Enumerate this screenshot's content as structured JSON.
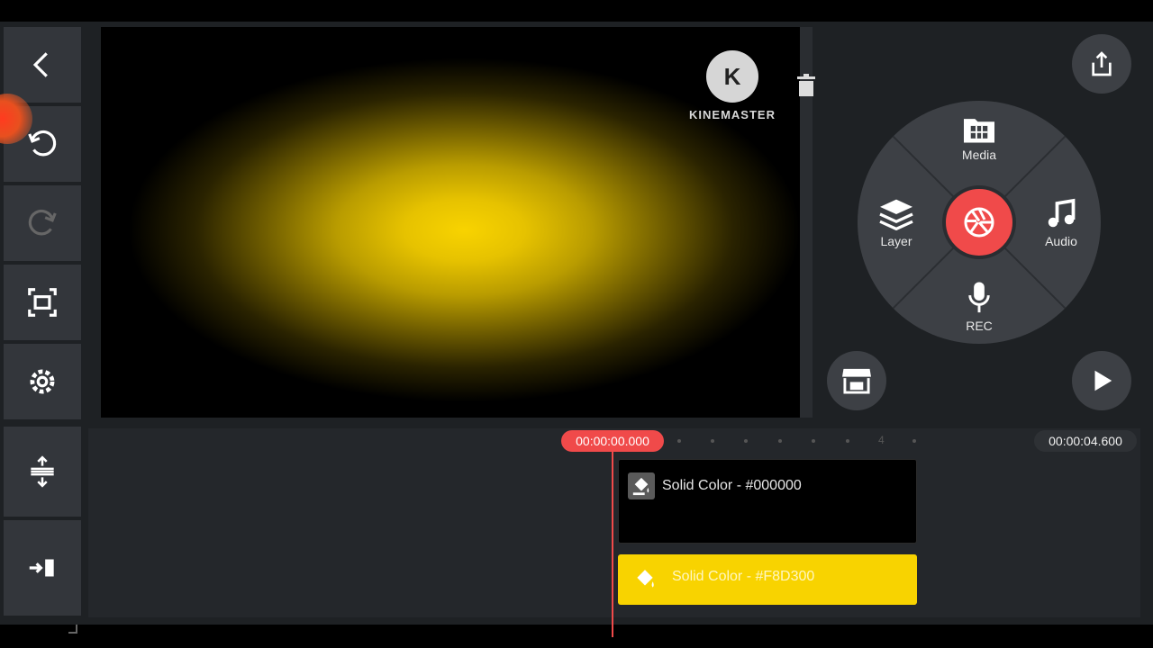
{
  "watermark": {
    "logo_letter": "K",
    "text": "KINEMASTER"
  },
  "wheel": {
    "media_label": "Media",
    "layer_label": "Layer",
    "audio_label": "Audio",
    "rec_label": "REC"
  },
  "timeline": {
    "current_time": "00:00:00.000",
    "total_time": "00:00:04.600",
    "tick_label": "4",
    "clips": [
      {
        "label": "Solid Color - #000000",
        "color": "#000000"
      },
      {
        "label": "Solid Color - #F8D300",
        "color": "#F8D300"
      }
    ]
  },
  "colors": {
    "accent": "#f04a4a",
    "panel": "#33363b",
    "background": "#1e2124",
    "highlight": "#f8d300"
  },
  "icons": {
    "back": "chevron-left-icon",
    "undo": "undo-icon",
    "redo": "redo-icon",
    "capture": "screen-capture-icon",
    "settings": "gear-icon",
    "timeline_expand": "expand-vertical-icon",
    "jump": "jump-to-end-icon",
    "share": "share-icon",
    "store": "store-icon",
    "play": "play-icon",
    "trash": "trash-icon"
  }
}
